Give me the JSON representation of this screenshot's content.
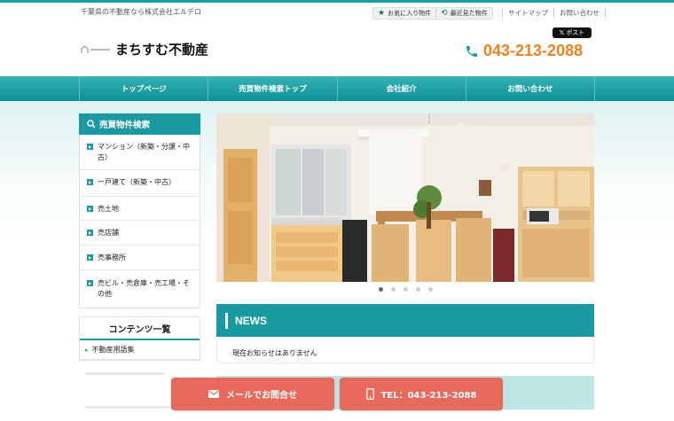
{
  "header": {
    "tagline": "千葉県の不動産なら株式会社エルデロ",
    "favorites": "お気に入り物件",
    "recent": "最近見た物件",
    "sitemap": "サイトマップ",
    "contact_link": "お問い合わせ",
    "x_post": "ポスト",
    "logo_name": "まちすむ不動産",
    "phone": "043-213-2088"
  },
  "nav": [
    "トップページ",
    "売買物件検索トップ",
    "会社紹介",
    "お問い合わせ"
  ],
  "sidebar": {
    "title": "売買物件検索",
    "items": [
      "マンション（新築・分譲・中古）",
      "一戸建て（新築・中古）",
      "売土地",
      "売店舗",
      "売事務所",
      "売ビル・売倉庫・売工場・その他"
    ]
  },
  "contents": {
    "title": "コンテンツ一覧",
    "items": [
      "不動産用語集"
    ]
  },
  "slider": {
    "dot_count": 5,
    "active_index": 0
  },
  "news": {
    "title": "NEWS",
    "empty": "現在お知らせはありません"
  },
  "cta": {
    "mail": "メールでお問合せ",
    "tel": "TEL：043-213-2088"
  },
  "colors": {
    "accent": "#1a9aa0",
    "phone": "#f0821e",
    "cta": "#e86a5c"
  }
}
